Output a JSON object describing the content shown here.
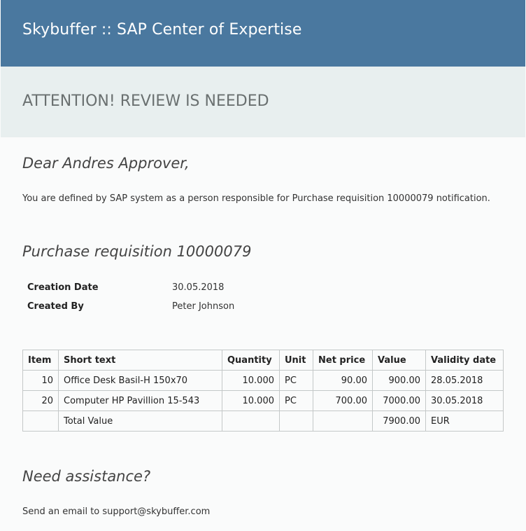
{
  "header": {
    "title": "Skybuffer :: SAP Center of Expertise"
  },
  "attention": {
    "text": "ATTENTION! REVIEW IS NEEDED"
  },
  "greeting": "Dear Andres Approver,",
  "intro": "You are defined by SAP system as a person responsible for Purchase requisition 10000079 notification.",
  "requisition": {
    "heading": "Purchase requisition 10000079",
    "creation_date_label": "Creation Date",
    "creation_date": "30.05.2018",
    "created_by_label": "Created By",
    "created_by": "Peter Johnson"
  },
  "table": {
    "headers": [
      "Item",
      "Short text",
      "Quantity",
      "Unit",
      "Net price",
      "Value",
      "Validity date"
    ],
    "rows": [
      [
        "10",
        "Office Desk Basil-H 150x70",
        "10.000",
        "PC",
        "90.00",
        "900.00",
        "28.05.2018"
      ],
      [
        "20",
        "Computer HP Pavillion 15-543",
        "10.000",
        "PC",
        "700.00",
        "7000.00",
        "30.05.2018"
      ]
    ],
    "total": {
      "label": "Total Value",
      "value": "7900.00",
      "currency": "EUR"
    }
  },
  "assistance": {
    "heading": "Need assistance?",
    "text": "Send an email to support@skybuffer.com"
  }
}
